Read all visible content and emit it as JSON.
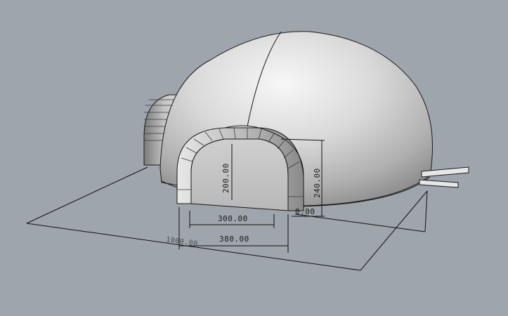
{
  "model": {
    "subject": "inflatable-dome-with-arched-entrance",
    "colors": {
      "background": "#9ea5ac",
      "surface_light": "#f2f2f2",
      "surface_mid": "#cfcfcf",
      "surface_dark": "#8e8e8e",
      "edge": "#1a1a1a"
    }
  },
  "dimensions": {
    "door_inner_width": "300.00",
    "door_outer_width": "380.00",
    "door_height": "200.00",
    "entrance_height": "240.00",
    "dome_diameter": "1000.00",
    "partial_label": "0.00"
  }
}
